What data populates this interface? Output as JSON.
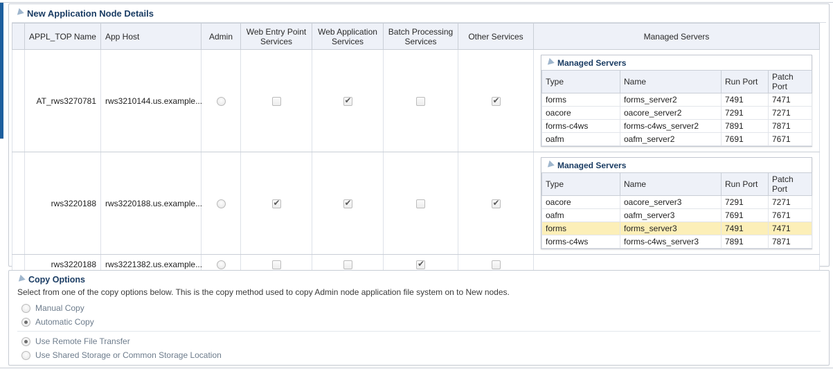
{
  "node_details": {
    "title": "New Application Node Details",
    "columns": [
      "APPL_TOP Name",
      "App Host",
      "Admin",
      "Web Entry Point Services",
      "Web Application Services",
      "Batch Processing Services",
      "Other Services",
      "Managed Servers"
    ],
    "rows": [
      {
        "appl_top_name": "AT_rws3270781",
        "app_host": "rws3210144.us.example...",
        "admin": false,
        "web_entry_point": false,
        "web_application": true,
        "batch_processing": false,
        "other_services": true,
        "managed_servers": {
          "title": "Managed Servers",
          "columns": [
            "Type",
            "Name",
            "Run Port",
            "Patch Port"
          ],
          "rows": [
            {
              "type": "forms",
              "name": "forms_server2",
              "run_port": "7491",
              "patch_port": "7471",
              "highlighted": false
            },
            {
              "type": "oacore",
              "name": "oacore_server2",
              "run_port": "7291",
              "patch_port": "7271",
              "highlighted": false
            },
            {
              "type": "forms-c4ws",
              "name": "forms-c4ws_server2",
              "run_port": "7891",
              "patch_port": "7871",
              "highlighted": false
            },
            {
              "type": "oafm",
              "name": "oafm_server2",
              "run_port": "7691",
              "patch_port": "7671",
              "highlighted": false
            }
          ]
        }
      },
      {
        "appl_top_name": "rws3220188",
        "app_host": "rws3220188.us.example...",
        "admin": false,
        "web_entry_point": true,
        "web_application": true,
        "batch_processing": false,
        "other_services": true,
        "managed_servers": {
          "title": "Managed Servers",
          "columns": [
            "Type",
            "Name",
            "Run Port",
            "Patch Port"
          ],
          "rows": [
            {
              "type": "oacore",
              "name": "oacore_server3",
              "run_port": "7291",
              "patch_port": "7271",
              "highlighted": false
            },
            {
              "type": "oafm",
              "name": "oafm_server3",
              "run_port": "7691",
              "patch_port": "7671",
              "highlighted": false
            },
            {
              "type": "forms",
              "name": "forms_server3",
              "run_port": "7491",
              "patch_port": "7471",
              "highlighted": true
            },
            {
              "type": "forms-c4ws",
              "name": "forms-c4ws_server3",
              "run_port": "7891",
              "patch_port": "7871",
              "highlighted": false
            }
          ]
        }
      },
      {
        "appl_top_name": "rws3220188",
        "app_host": "rws3221382.us.example...",
        "admin": false,
        "web_entry_point": false,
        "web_application": false,
        "batch_processing": true,
        "other_services": false,
        "managed_servers": null
      }
    ]
  },
  "copy_options": {
    "title": "Copy Options",
    "description": "Select from one of the copy options below. This is the copy method used to copy Admin node application file system on to New nodes.",
    "method_options": [
      {
        "label": "Manual Copy",
        "selected": false
      },
      {
        "label": "Automatic Copy",
        "selected": true
      }
    ],
    "transfer_options": [
      {
        "label": "Use Remote File Transfer",
        "selected": true
      },
      {
        "label": "Use Shared Storage or Common Storage Location",
        "selected": false
      }
    ]
  },
  "colors": {
    "accent_bar": "#1d5f9e",
    "header_bg": "#eef1f8",
    "panel_title": "#1a3c63",
    "highlight_row": "#fcefb8",
    "border": "#c9ced6"
  }
}
